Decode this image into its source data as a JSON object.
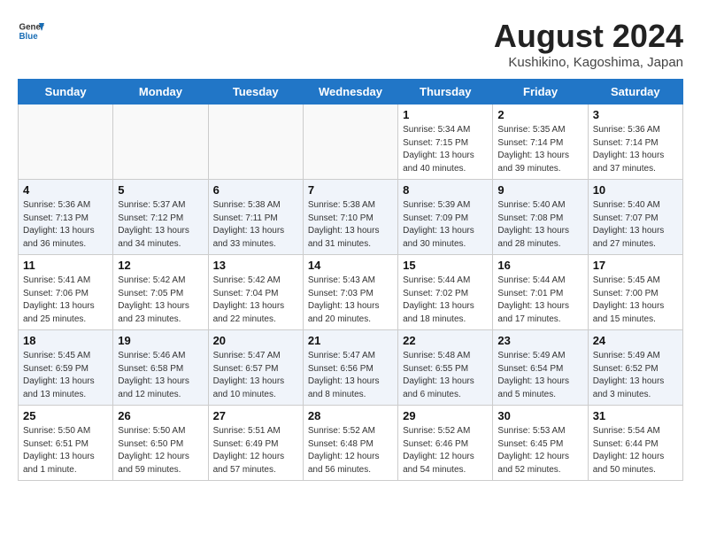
{
  "header": {
    "logo_line1": "General",
    "logo_line2": "Blue",
    "month": "August 2024",
    "location": "Kushikino, Kagoshima, Japan"
  },
  "weekdays": [
    "Sunday",
    "Monday",
    "Tuesday",
    "Wednesday",
    "Thursday",
    "Friday",
    "Saturday"
  ],
  "weeks": [
    [
      {
        "day": "",
        "info": ""
      },
      {
        "day": "",
        "info": ""
      },
      {
        "day": "",
        "info": ""
      },
      {
        "day": "",
        "info": ""
      },
      {
        "day": "1",
        "info": "Sunrise: 5:34 AM\nSunset: 7:15 PM\nDaylight: 13 hours\nand 40 minutes."
      },
      {
        "day": "2",
        "info": "Sunrise: 5:35 AM\nSunset: 7:14 PM\nDaylight: 13 hours\nand 39 minutes."
      },
      {
        "day": "3",
        "info": "Sunrise: 5:36 AM\nSunset: 7:14 PM\nDaylight: 13 hours\nand 37 minutes."
      }
    ],
    [
      {
        "day": "4",
        "info": "Sunrise: 5:36 AM\nSunset: 7:13 PM\nDaylight: 13 hours\nand 36 minutes."
      },
      {
        "day": "5",
        "info": "Sunrise: 5:37 AM\nSunset: 7:12 PM\nDaylight: 13 hours\nand 34 minutes."
      },
      {
        "day": "6",
        "info": "Sunrise: 5:38 AM\nSunset: 7:11 PM\nDaylight: 13 hours\nand 33 minutes."
      },
      {
        "day": "7",
        "info": "Sunrise: 5:38 AM\nSunset: 7:10 PM\nDaylight: 13 hours\nand 31 minutes."
      },
      {
        "day": "8",
        "info": "Sunrise: 5:39 AM\nSunset: 7:09 PM\nDaylight: 13 hours\nand 30 minutes."
      },
      {
        "day": "9",
        "info": "Sunrise: 5:40 AM\nSunset: 7:08 PM\nDaylight: 13 hours\nand 28 minutes."
      },
      {
        "day": "10",
        "info": "Sunrise: 5:40 AM\nSunset: 7:07 PM\nDaylight: 13 hours\nand 27 minutes."
      }
    ],
    [
      {
        "day": "11",
        "info": "Sunrise: 5:41 AM\nSunset: 7:06 PM\nDaylight: 13 hours\nand 25 minutes."
      },
      {
        "day": "12",
        "info": "Sunrise: 5:42 AM\nSunset: 7:05 PM\nDaylight: 13 hours\nand 23 minutes."
      },
      {
        "day": "13",
        "info": "Sunrise: 5:42 AM\nSunset: 7:04 PM\nDaylight: 13 hours\nand 22 minutes."
      },
      {
        "day": "14",
        "info": "Sunrise: 5:43 AM\nSunset: 7:03 PM\nDaylight: 13 hours\nand 20 minutes."
      },
      {
        "day": "15",
        "info": "Sunrise: 5:44 AM\nSunset: 7:02 PM\nDaylight: 13 hours\nand 18 minutes."
      },
      {
        "day": "16",
        "info": "Sunrise: 5:44 AM\nSunset: 7:01 PM\nDaylight: 13 hours\nand 17 minutes."
      },
      {
        "day": "17",
        "info": "Sunrise: 5:45 AM\nSunset: 7:00 PM\nDaylight: 13 hours\nand 15 minutes."
      }
    ],
    [
      {
        "day": "18",
        "info": "Sunrise: 5:45 AM\nSunset: 6:59 PM\nDaylight: 13 hours\nand 13 minutes."
      },
      {
        "day": "19",
        "info": "Sunrise: 5:46 AM\nSunset: 6:58 PM\nDaylight: 13 hours\nand 12 minutes."
      },
      {
        "day": "20",
        "info": "Sunrise: 5:47 AM\nSunset: 6:57 PM\nDaylight: 13 hours\nand 10 minutes."
      },
      {
        "day": "21",
        "info": "Sunrise: 5:47 AM\nSunset: 6:56 PM\nDaylight: 13 hours\nand 8 minutes."
      },
      {
        "day": "22",
        "info": "Sunrise: 5:48 AM\nSunset: 6:55 PM\nDaylight: 13 hours\nand 6 minutes."
      },
      {
        "day": "23",
        "info": "Sunrise: 5:49 AM\nSunset: 6:54 PM\nDaylight: 13 hours\nand 5 minutes."
      },
      {
        "day": "24",
        "info": "Sunrise: 5:49 AM\nSunset: 6:52 PM\nDaylight: 13 hours\nand 3 minutes."
      }
    ],
    [
      {
        "day": "25",
        "info": "Sunrise: 5:50 AM\nSunset: 6:51 PM\nDaylight: 13 hours\nand 1 minute."
      },
      {
        "day": "26",
        "info": "Sunrise: 5:50 AM\nSunset: 6:50 PM\nDaylight: 12 hours\nand 59 minutes."
      },
      {
        "day": "27",
        "info": "Sunrise: 5:51 AM\nSunset: 6:49 PM\nDaylight: 12 hours\nand 57 minutes."
      },
      {
        "day": "28",
        "info": "Sunrise: 5:52 AM\nSunset: 6:48 PM\nDaylight: 12 hours\nand 56 minutes."
      },
      {
        "day": "29",
        "info": "Sunrise: 5:52 AM\nSunset: 6:46 PM\nDaylight: 12 hours\nand 54 minutes."
      },
      {
        "day": "30",
        "info": "Sunrise: 5:53 AM\nSunset: 6:45 PM\nDaylight: 12 hours\nand 52 minutes."
      },
      {
        "day": "31",
        "info": "Sunrise: 5:54 AM\nSunset: 6:44 PM\nDaylight: 12 hours\nand 50 minutes."
      }
    ]
  ]
}
